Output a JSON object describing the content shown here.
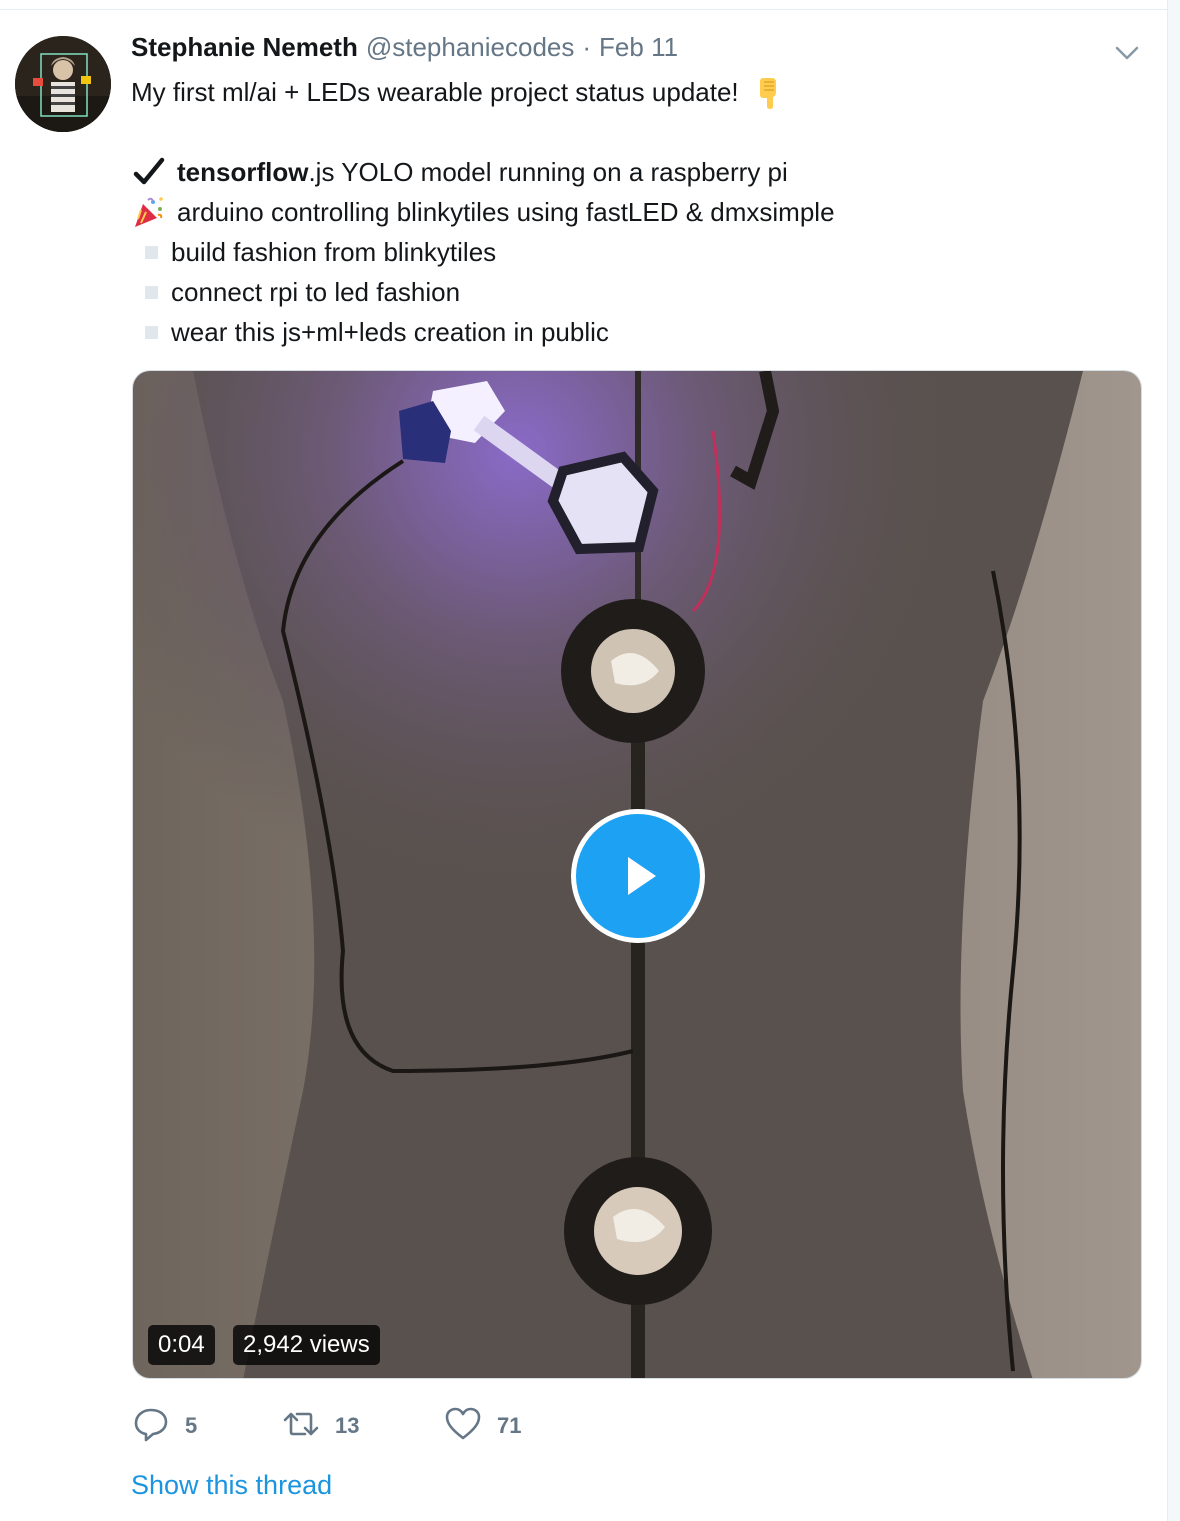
{
  "tweet": {
    "author_name": "Stephanie Nemeth",
    "handle": "@stephaniecodes",
    "separator": "·",
    "date": "Feb 11",
    "caret_icon": "chevron-down-icon",
    "intro": "My first ml/ai + LEDs wearable project status update!",
    "intro_emoji": "backhand-index-pointing-down-icon",
    "checklist": {
      "done_1_emoji": "heavy-check-mark-icon",
      "done_1_bold": "tensorflow",
      "done_1_rest": ".js YOLO model running on a raspberry pi",
      "done_2_emoji": "party-popper-icon",
      "done_2_text": "arduino controlling blinkytiles using fastLED & dmxsimple",
      "todo": [
        "build fashion from blinkytiles",
        "connect rpi to led fashion",
        "wear this js+ml+leds creation in public"
      ]
    },
    "video": {
      "duration": "0:04",
      "views": "2,942 views",
      "play_icon": "play-icon"
    },
    "actions": {
      "replies": "5",
      "retweets": "13",
      "likes": "71"
    },
    "show_thread": "Show this thread"
  },
  "colors": {
    "accent": "#1da1f2",
    "link": "#1b95e0",
    "muted": "#657786"
  }
}
